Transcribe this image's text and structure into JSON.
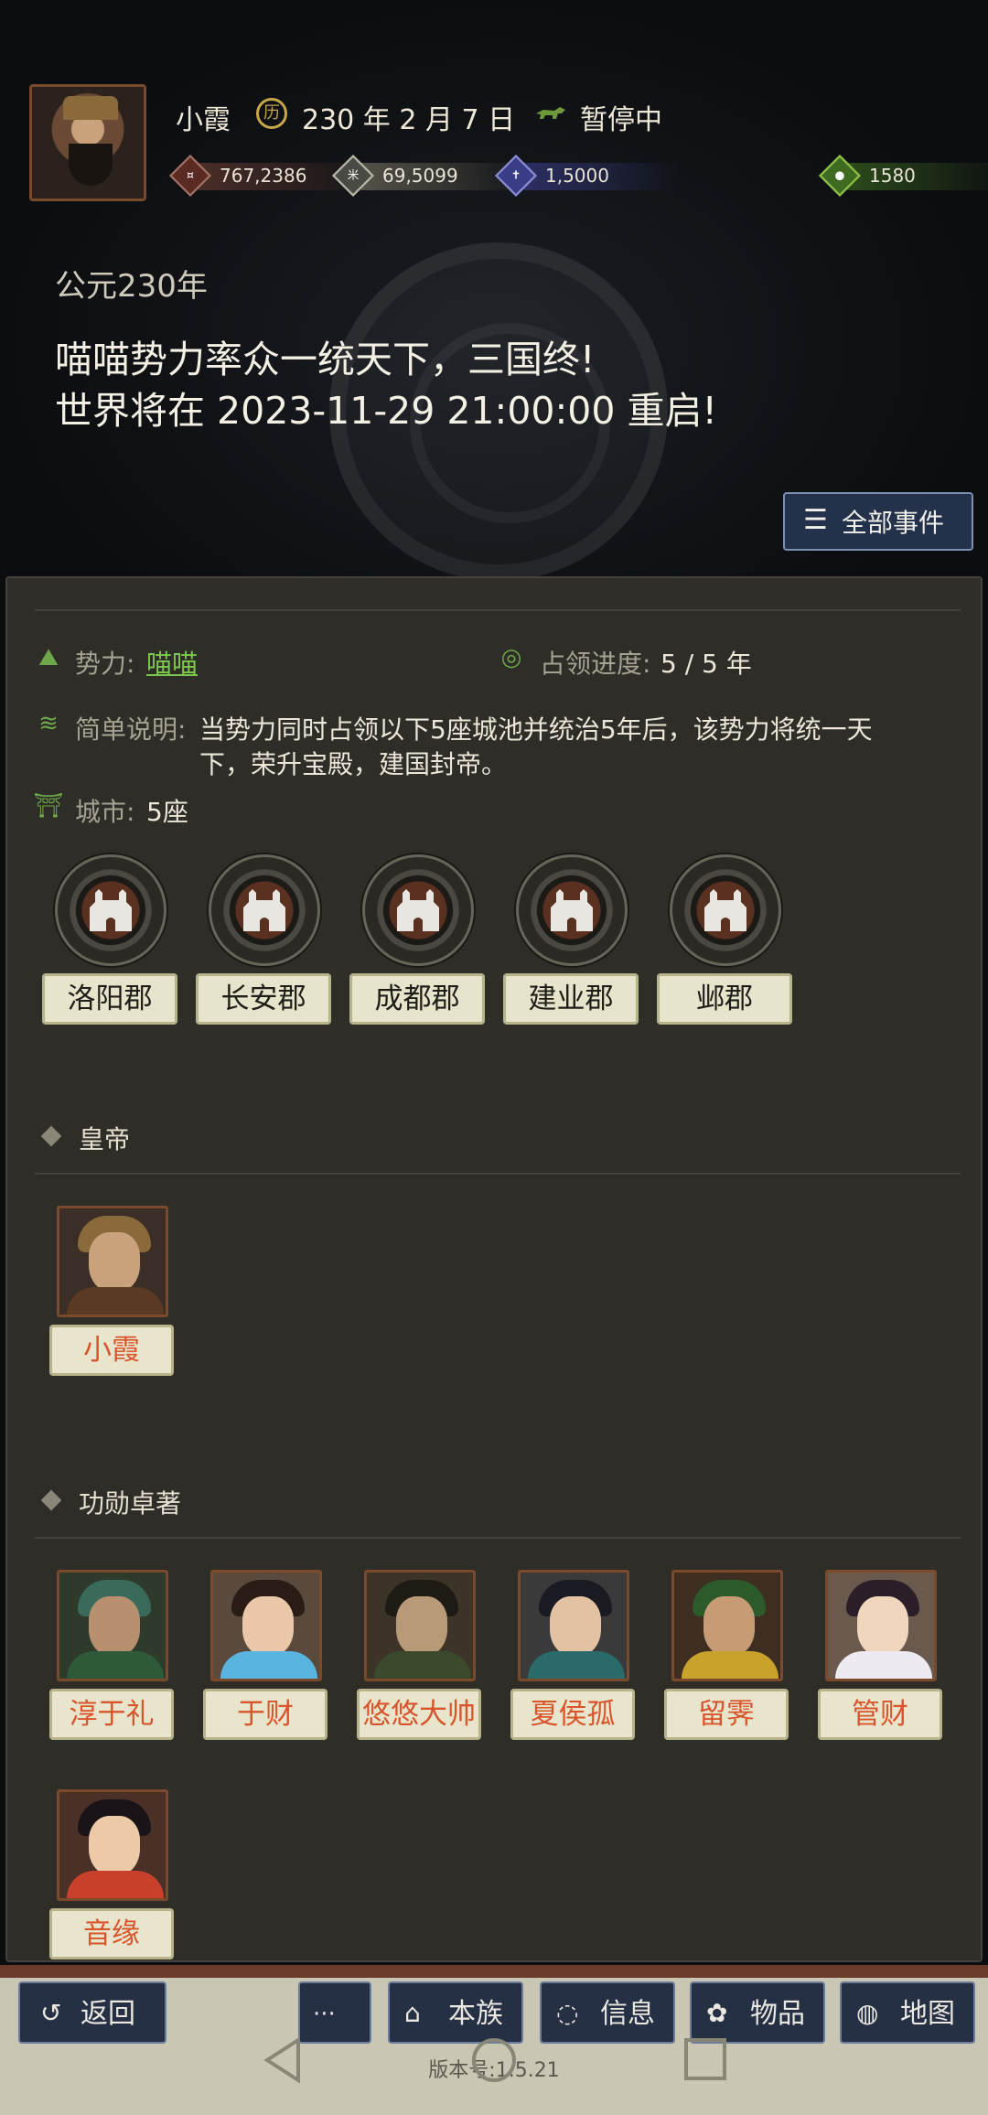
{
  "header": {
    "player_name": "小霞",
    "date": "230 年 2 月 7 日",
    "status": "暂停中",
    "resources": [
      {
        "name": "copper",
        "value": "767,2386",
        "icon": "coin-icon"
      },
      {
        "name": "silver",
        "value": "69,5099",
        "icon": "grain-icon"
      },
      {
        "name": "troops",
        "value": "1,5000",
        "icon": "soldier-icon"
      },
      {
        "name": "gold",
        "value": "1580",
        "icon": "money-bag-icon"
      }
    ],
    "era": "公元230年",
    "headline_line1": "喵喵势力率众一统天下，三国终!",
    "headline_line2": "世界将在 2023-11-29 21:00:00 重启!",
    "all_events_label": "全部事件"
  },
  "info": {
    "faction_label": "势力:",
    "faction_value": "喵喵",
    "progress_label": "占领进度:",
    "progress_value": "5 / 5 年",
    "desc_label": "简单说明:",
    "desc_line1": "当势力同时占领以下5座城池并统治5年后，该势力将统一天",
    "desc_line2": "下，荣升宝殿，建国封帝。",
    "city_label": "城市:",
    "city_value": "5座"
  },
  "cities": [
    "洛阳郡",
    "长安郡",
    "成都郡",
    "建业郡",
    "邺郡"
  ],
  "emperor": {
    "title": "皇帝",
    "heroes": [
      "小霞"
    ]
  },
  "merit": {
    "title": "功勋卓著",
    "heroes": [
      "淳于礼",
      "于财",
      "悠悠大帅",
      "夏侯孤",
      "留霁",
      "管财",
      "音缘"
    ]
  },
  "bottom_bar": {
    "back": "返回",
    "more": "···",
    "clan": "本族",
    "info": "信息",
    "items": "物品",
    "map": "地图",
    "version": "版本号:1.5.21"
  },
  "colors": {
    "accent_green": "#7cc84c",
    "hero_name": "#d8552c",
    "button_blue": "#253045"
  }
}
